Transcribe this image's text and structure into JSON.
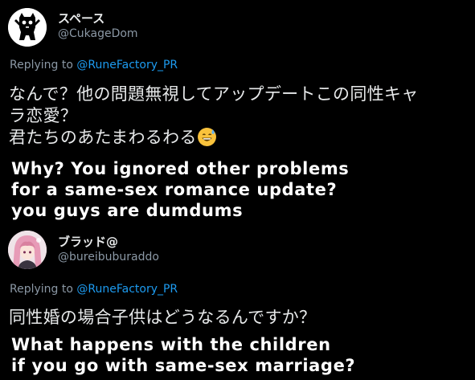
{
  "post1": {
    "display_name": "スペース",
    "handle": "@CukageDom",
    "replying_prefix": "Replying to",
    "replying_to": "@RuneFactory_PR",
    "text_line1": "なんで？他の問題無視してアップデートこの同性キャ",
    "text_line2": "ラ恋愛？",
    "text_line3": "君たちのあたまわるわる",
    "emoji": "grinning-face-with-sweat-icon",
    "translation": [
      "Why? You ignored other problems",
      "for a same-sex romance update?",
      "you guys are dumdums"
    ]
  },
  "post2": {
    "display_name": "ブラッド@",
    "handle": "@bureibuburaddo",
    "replying_prefix": "Replying to",
    "replying_to": "@RuneFactory_PR",
    "text_line1": "同性婚の場合子供はどうなるんですか？",
    "translation": [
      "What happens with the children",
      "if you go with same-sex marriage?"
    ]
  }
}
